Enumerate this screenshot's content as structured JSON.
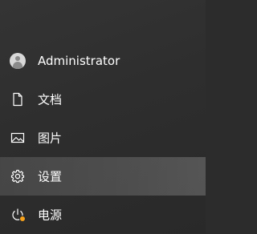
{
  "start_menu": {
    "items": [
      {
        "label": "Administrator",
        "icon": "user-avatar-icon"
      },
      {
        "label": "文档",
        "icon": "document-icon"
      },
      {
        "label": "图片",
        "icon": "picture-icon"
      },
      {
        "label": "设置",
        "icon": "gear-icon",
        "selected": true
      },
      {
        "label": "电源",
        "icon": "power-icon",
        "badge_color": "#f7a21b"
      }
    ]
  }
}
